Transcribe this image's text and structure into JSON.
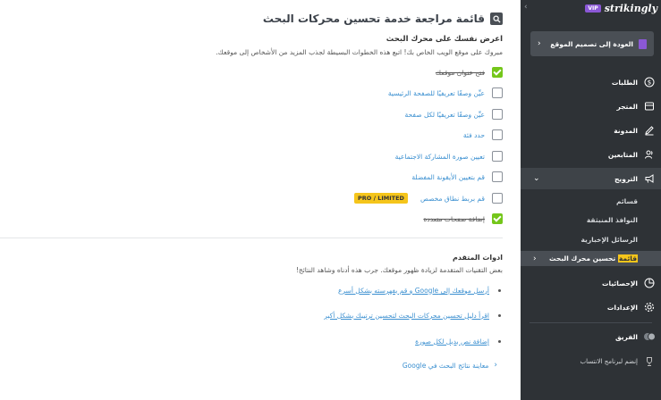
{
  "main": {
    "title": "قائمة مراجعة خدمة تحسين محركات البحث",
    "section1": {
      "title": "اعرض نفسك على محرك البحث",
      "description": "مبروك على موقع الويب الخاص بك! اتبع هذه الخطوات البسيطة لجذب المزيد من الأشخاص إلى موقعك."
    },
    "checklist": [
      {
        "label": "فتح عنوان موقعك",
        "checked": true
      },
      {
        "label": "عيِّن وصفًا تعريفيًا للصفحة الرئيسية",
        "checked": false
      },
      {
        "label": "عيِّن وصفًا تعريفيًا لكل صفحة",
        "checked": false
      },
      {
        "label": "حدد فئة",
        "checked": false
      },
      {
        "label": "تعيين صورة المشاركة الاجتماعية",
        "checked": false
      },
      {
        "label": "قم بتعيين الأيقونة المفضلة",
        "checked": false
      },
      {
        "label": "قم بربط نطاق مخصص",
        "checked": false,
        "badge": "PRO / LIMITED"
      },
      {
        "label": "إضافة صفحات متعددة",
        "checked": true
      }
    ],
    "section2": {
      "title": "ادوات المتقدم",
      "description": "بعض التقنيات المتقدمة لزيادة ظهور موقعك. جرب هذه أدناه وشاهد النتائج!"
    },
    "tools": [
      {
        "label": "أرسل موقعك إلى Google و قم بفهرسته بشكل أسرع"
      },
      {
        "label": "اقرأ دليل تحسين محركات البحث لتحسين ترتيبك بشكل أكبر"
      },
      {
        "label": "إضافة نص بديل لكل صورة"
      }
    ],
    "preview_link": "معاينة نتائج البحث في Google"
  },
  "sidebar": {
    "brand": "strikingly",
    "vip": "VIP",
    "back_button": "العودة إلى تصميم الموقع",
    "items": {
      "orders": "الطلبات",
      "store": "المتجر",
      "blog": "المدونة",
      "followers": "المتابعين",
      "promotion": "الترويج",
      "stats": "الإحصائيات",
      "settings": "الإعدادات",
      "team": "الفريق",
      "affiliate": "إنضم لبرنامج الانتساب"
    },
    "promotion_sub": {
      "coupons": "قسائم",
      "popups": "النوافذ المنبثقة",
      "newsletters": "الرسائل الإخبارية",
      "seo_prefix": "قائمة",
      "seo_rest": " تحسين محرك البحث"
    }
  },
  "colors": {
    "link": "#3a8fd0",
    "check_green": "#74c61a",
    "badge_yellow": "#f5c51b",
    "sidebar_bg": "#2e3236",
    "vip_purple": "#8b58d6"
  }
}
